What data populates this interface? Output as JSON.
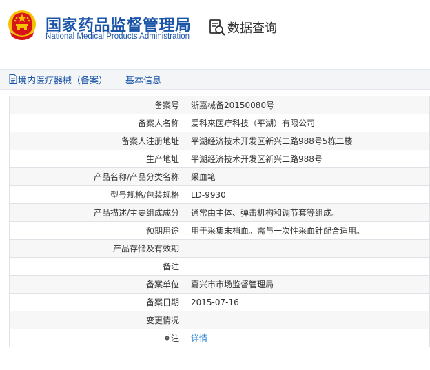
{
  "header": {
    "brand_cn": "国家药品监督管理局",
    "brand_en": "National Medical Products Administration",
    "query_title": "数据查询"
  },
  "breadcrumb": {
    "text": "境内医疗器械（备案）——基本信息"
  },
  "record": {
    "rows": [
      {
        "label": "备案号",
        "value": "浙嘉械备20150080号"
      },
      {
        "label": "备案人名称",
        "value": "爱科来医疗科技（平湖）有限公司"
      },
      {
        "label": "备案人注册地址",
        "value": "平湖经济技术开发区新兴二路988号5栋二楼"
      },
      {
        "label": "生产地址",
        "value": "平湖经济技术开发区新兴二路988号"
      },
      {
        "label": "产品名称/产品分类名称",
        "value": "采血笔"
      },
      {
        "label": "型号规格/包装规格",
        "value": "LD-9930"
      },
      {
        "label": "产品描述/主要组成成分",
        "value": "通常由主体、弹击机构和调节套等组成。"
      },
      {
        "label": "预期用途",
        "value": "用于采集末梢血。需与一次性采血针配合适用。"
      },
      {
        "label": "产品存储及有效期",
        "value": ""
      },
      {
        "label": "备注",
        "value": ""
      },
      {
        "label": "备案单位",
        "value": "嘉兴市市场监督管理局"
      },
      {
        "label": "备案日期",
        "value": "2015-07-16"
      },
      {
        "label": "变更情况",
        "value": ""
      }
    ],
    "note_label": "注",
    "detail_link": "详情"
  },
  "colors": {
    "brand_blue": "#1b55a8",
    "link_blue": "#1b7ed6",
    "emblem_red": "#d7141a",
    "emblem_gold": "#f6c100"
  }
}
